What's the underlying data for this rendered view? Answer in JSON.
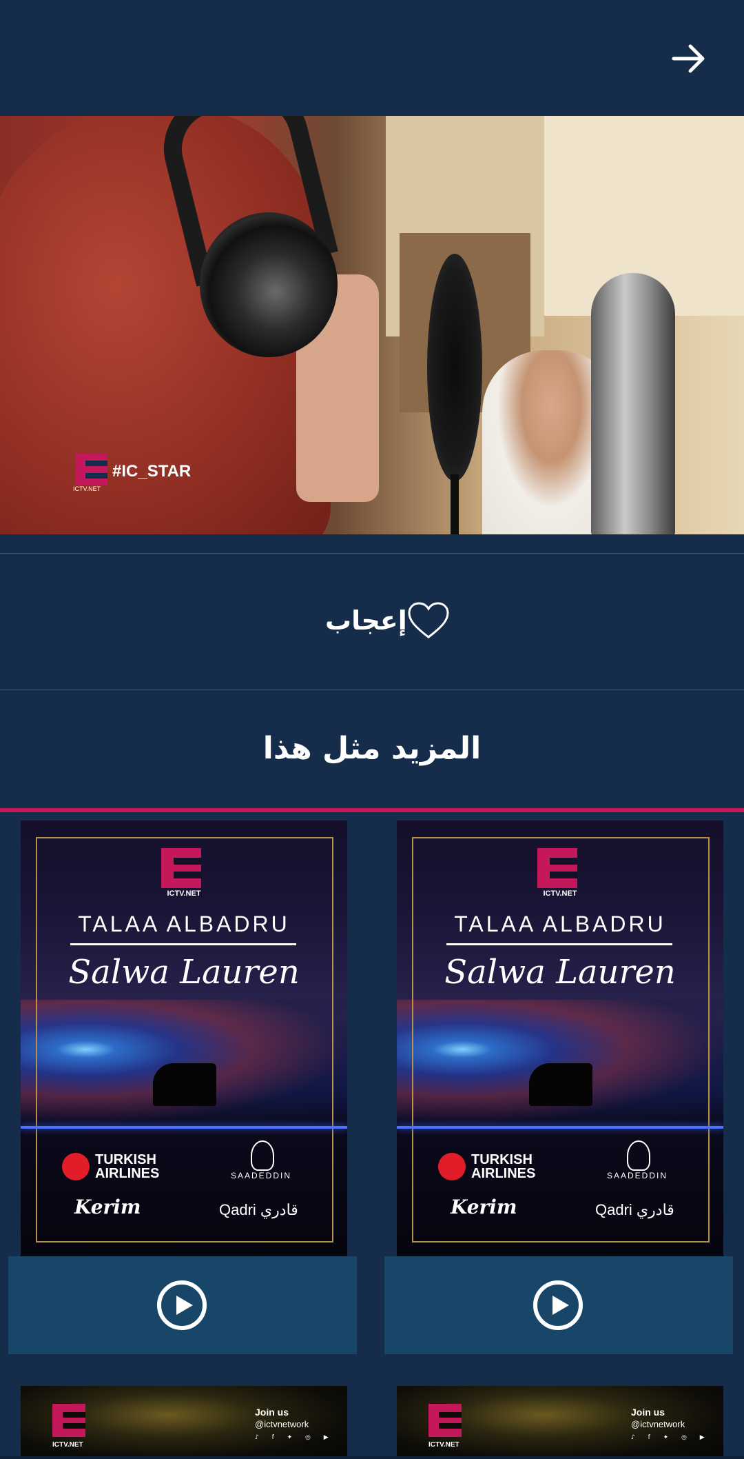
{
  "header": {
    "back_icon": "arrow-right-icon"
  },
  "hero": {
    "watermark_logo_text": "ICTV.NET",
    "watermark_tag": "#IC_STAR"
  },
  "like": {
    "label": "إعجاب",
    "icon": "heart-outline-icon"
  },
  "more": {
    "title": "المزيد مثل هذا",
    "accent_color": "#c4185a"
  },
  "cards": [
    {
      "logo_text": "ICTV.NET",
      "title": "TALAA ALBADRU",
      "artist": "Salwa Lauren",
      "sponsor1": "TURKISH AIRLINES",
      "sponsor2": "SAADEDDIN",
      "sponsor3": "Kerim",
      "sponsor4": "Qadri قادري",
      "play_icon": "play-circle-icon"
    },
    {
      "logo_text": "ICTV.NET",
      "title": "TALAA ALBADRU",
      "artist": "Salwa Lauren",
      "sponsor1": "TURKISH AIRLINES",
      "sponsor2": "SAADEDDIN",
      "sponsor3": "Kerim",
      "sponsor4": "Qadri قادري",
      "play_icon": "play-circle-icon"
    }
  ],
  "mini_cards": [
    {
      "logo_text": "ICTV.NET",
      "join": "Join us",
      "handle": "@ictvnetwork"
    },
    {
      "logo_text": "ICTV.NET",
      "join": "Join us",
      "handle": "@ictvnetwork"
    }
  ],
  "colors": {
    "background": "#152c4a",
    "play_bar": "#174668",
    "ictv_red": "#c4185a"
  }
}
